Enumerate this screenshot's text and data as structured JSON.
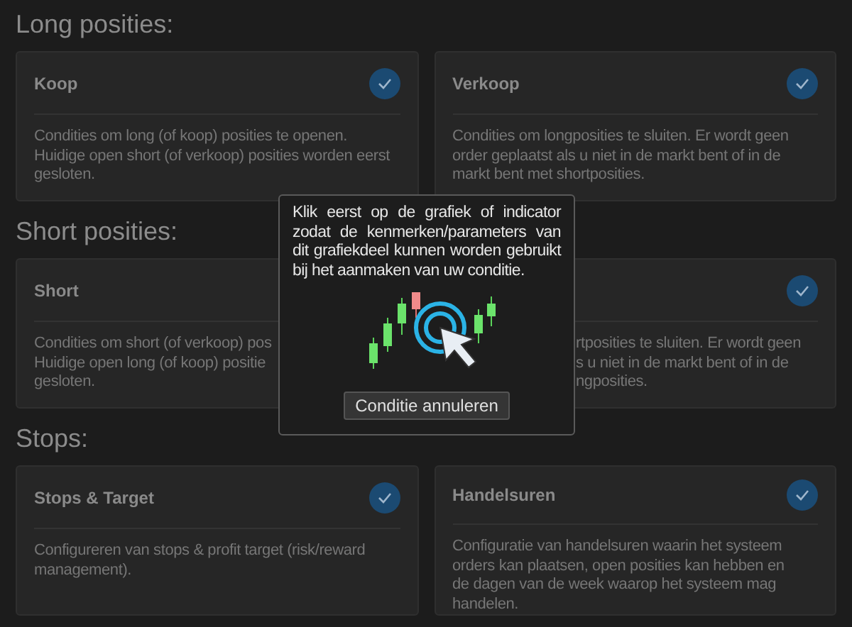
{
  "sections": [
    {
      "title": "Long posities:",
      "cards": [
        {
          "kind": "full",
          "title": "Koop",
          "checked": true,
          "lines": [
            "Condities om long (of koop) posities te openen.",
            "Huidige open short (of verkoop) posities worden eerst",
            "gesloten."
          ]
        },
        {
          "kind": "full",
          "title": "Verkoop",
          "checked": true,
          "lines": [
            "Condities om longposities te sluiten. Er wordt geen",
            "order geplaatst als u niet in de markt bent of in de",
            "markt bent met shortposities."
          ]
        }
      ]
    },
    {
      "title": "Short posities:",
      "cards": [
        {
          "kind": "cut_right",
          "title": "Short",
          "lines": [
            "Condities om short (of verkoop) pos",
            "Huidige open long (of koop) positie",
            "gesloten."
          ]
        },
        {
          "kind": "cut_left",
          "checked": true,
          "lines": [
            "rtposities te sluiten. Er wordt geen",
            "s u niet in de markt bent of in de",
            "ngposities."
          ]
        }
      ]
    },
    {
      "title": "Stops:",
      "cards": [
        {
          "kind": "full",
          "title": "Stops & Target",
          "checked": true,
          "lines": [
            "Configureren van stops & profit target (risk/reward",
            "management)."
          ]
        },
        {
          "kind": "full",
          "title": "Handelsuren",
          "checked": true,
          "lines": [
            "Configuratie van handelsuren waarin het systeem",
            "orders kan plaatsen, open posities kan hebben en",
            "de dagen van de week waarop het systeem mag",
            "handelen."
          ]
        }
      ]
    }
  ],
  "dialog": {
    "message": "Klik eerst op de grafiek of indicator zodat de kenmerken/parameters van dit grafiekdeel kunnen worden gebruikt bij het aanmaken van uw conditie.",
    "button": "Conditie annuleren"
  }
}
